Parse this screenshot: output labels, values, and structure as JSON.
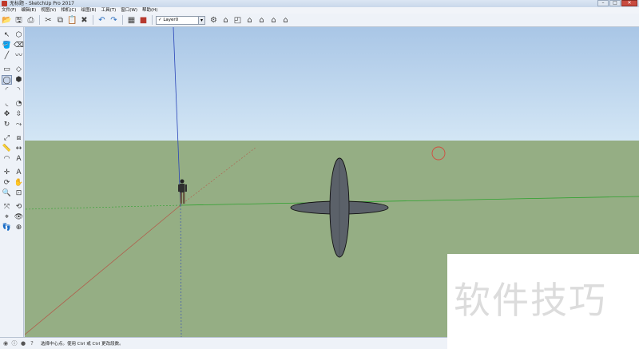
{
  "window": {
    "title": "无标题 - SketchUp Pro 2017",
    "controls": {
      "minimize": "–",
      "maximize": "□",
      "close": "✕"
    }
  },
  "menu": [
    "文件(F)",
    "编辑(E)",
    "视图(V)",
    "相机(C)",
    "绘图(R)",
    "工具(T)",
    "窗口(W)",
    "帮助(H)"
  ],
  "toolbar": {
    "left_icons": [
      "open-file-icon",
      "save-icon",
      "print-icon",
      "cut-icon",
      "copy-icon",
      "paste-icon",
      "erase-icon"
    ],
    "undo_icons": [
      "undo-icon",
      "redo-icon"
    ],
    "model_icons": [
      "model-info-icon",
      "components-icon"
    ],
    "layer": {
      "check": "✓",
      "name": "Layer0",
      "chevron": "▾"
    },
    "view_icons": [
      "layers-panel-icon",
      "iso-view-icon",
      "top-view-icon",
      "front-view-icon",
      "right-view-icon",
      "back-view-icon",
      "left-view-icon"
    ]
  },
  "palette": {
    "tools": [
      "select-icon",
      "make-component-icon",
      "paint-bucket-icon",
      "eraser-icon",
      "line-icon",
      "freehand-icon",
      "rectangle-icon",
      "rotated-rectangle-icon",
      "circle-icon",
      "polygon-icon",
      "arc-icon",
      "two-point-arc-icon",
      "three-point-arc-icon",
      "pie-icon",
      "move-icon",
      "push-pull-icon",
      "rotate-icon",
      "follow-me-icon",
      "scale-icon",
      "offset-icon",
      "tape-measure-icon",
      "dimension-icon",
      "protractor-icon",
      "text-icon",
      "axes-icon",
      "3d-text-icon",
      "orbit-icon",
      "pan-icon",
      "zoom-icon",
      "zoom-window-icon",
      "zoom-extents-icon",
      "previous-view-icon",
      "position-camera-icon",
      "look-around-icon",
      "walk-icon",
      "section-plane-icon"
    ],
    "selected_index": 8
  },
  "status": {
    "icons": [
      "geo-location-icon",
      "credits-icon",
      "user-icon",
      "help-icon"
    ],
    "text": "选择中心点。使用 Ctrl 或 Ctrl 更改段数。"
  },
  "colors": {
    "sky_top": "#a9c6e6",
    "ground": "#95ae84",
    "shape_fill": "#5b6169",
    "axis_red": "#b25b4a",
    "axis_green": "#2fa12f",
    "axis_blue": "#2a45b8",
    "cursor_circle": "#d34b3e"
  },
  "watermark": "软件技巧"
}
